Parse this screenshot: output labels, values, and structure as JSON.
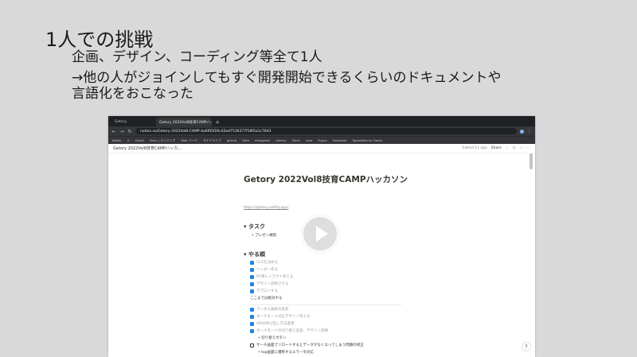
{
  "slide": {
    "title": "1人での挑戦",
    "line1": "企画、デザイン、コーディング等全て1人",
    "line2": "→他の人がジョインしてもすぐ開発開始できるくらいのドキュメントや",
    "line3": "言語化をおこなった"
  },
  "browser": {
    "tabs": [
      "Getory",
      "Getory 2022Vol8技育CAMPハッ"
    ],
    "new_tab": "+",
    "url": "notion.so/Getory-2022Vol8-CAMP-4a6f05f26c42ad7536377f18f5a1c7643",
    "bookmarks": [
      "Twitter",
      "G",
      "Gmail",
      "Zenn | エンジニア",
      "Web ページ",
      "マイドライブ",
      "github",
      "Qiita",
      "Instagram",
      "Udemy",
      "Slack",
      "note",
      "Figma",
      "Facebook",
      "Speedtest by Ookla"
    ]
  },
  "notion": {
    "breadcrumb": "Getory 2022Vol8技育CAMPハッカ...",
    "edited": "Edited 11 ago",
    "share": "Share",
    "page_title": "Getory 2022Vol8技育CAMPハッカソン",
    "link": "https://getory.netlify.app/",
    "section1": "タスク",
    "section1_bullets": [
      "プレゼン練習"
    ],
    "section2": "やる順",
    "todos_a": [
      "ロゴを決める",
      "ヘッダー作る",
      "PC用レイアウト考える",
      "デザイン反映させる",
      "デプロイする"
    ],
    "note": "ここまでは絶対やる",
    "todos_b": [
      "ランダム検索の実装",
      "ダークモード対応デザイン考える",
      "APIの呼び出し方法変更",
      "ダークモードの切り替え実装、デザイン反映"
    ],
    "sub_bullet": "切り替えボタン",
    "todo_open": "サーチ画面でリロードするとデータがなくなってしまう問題の修正",
    "sub_bullet2": "top画面に遷移するエラー文対応",
    "help": "?"
  }
}
